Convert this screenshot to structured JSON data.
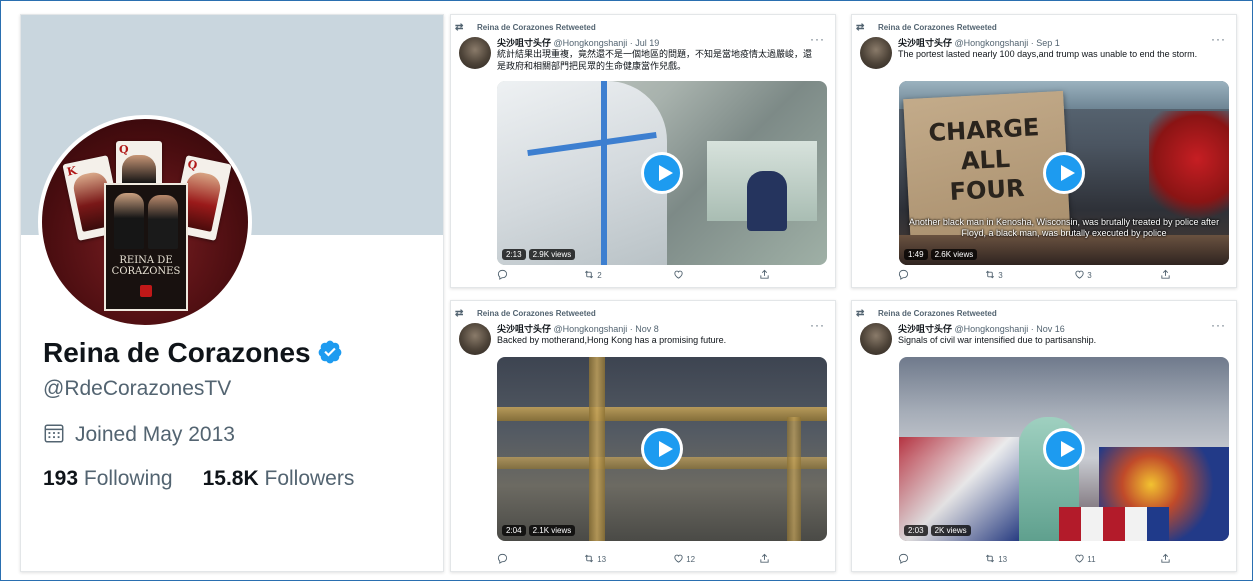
{
  "profile": {
    "name": "Reina de Corazones",
    "handle": "@RdeCorazonesTV",
    "joined": "Joined May 2013",
    "following_count": "193",
    "following_label": "Following",
    "followers_count": "15.8K",
    "followers_label": "Followers",
    "poster_title": "REINA DE CORAZONES",
    "card_letters": [
      "K",
      "Q",
      "Q"
    ]
  },
  "tweets": [
    {
      "retweet_label": "Reina de Corazones Retweeted",
      "author_name": "尖沙咀寸头仔",
      "author_meta": "@Hongkongshanji · Jul 19",
      "text": "統計結果出現重複，竟然還不是一個地區的問題，不知是當地疫情太過嚴峻，還是政府和相關部門把民眾的生命健康當作兒戲。",
      "duration": "2:13",
      "views": "2.9K views",
      "replies": "",
      "retweets": "2",
      "likes": "",
      "subtitle": ""
    },
    {
      "retweet_label": "Reina de Corazones Retweeted",
      "author_name": "尖沙咀寸头仔",
      "author_meta": "@Hongkongshanji · Sep 1",
      "text": "The portest lasted nearly 100 days,and trump was unable to end the storm.",
      "duration": "1:49",
      "views": "2.6K views",
      "replies": "",
      "retweets": "3",
      "likes": "3",
      "subtitle": "Another black man in Kenosha, Wisconsin, was brutally treated by police after Floyd, a black man, was brutally executed by police",
      "sign_text": "CHARGE ALL FOUR"
    },
    {
      "retweet_label": "Reina de Corazones Retweeted",
      "author_name": "尖沙咀寸头仔",
      "author_meta": "@Hongkongshanji · Nov 8",
      "text": "Backed by motherand,Hong Kong has a promising future.",
      "duration": "2:04",
      "views": "2.1K views",
      "replies": "",
      "retweets": "13",
      "likes": "12",
      "subtitle": ""
    },
    {
      "retweet_label": "Reina de Corazones Retweeted",
      "author_name": "尖沙咀寸头仔",
      "author_meta": "@Hongkongshanji · Nov 16",
      "text": "Signals of civil war intensified due to partisanship.",
      "duration": "2:03",
      "views": "2K views",
      "replies": "",
      "retweets": "13",
      "likes": "11",
      "subtitle": ""
    }
  ],
  "icons": {
    "retweet": "retweet-icon",
    "reply": "reply-icon",
    "like": "heart-icon",
    "share": "share-icon",
    "verified": "verified-badge-icon",
    "calendar": "calendar-icon",
    "play": "play-icon",
    "more": "more-icon"
  },
  "colors": {
    "accent": "#1d9bf0",
    "banner": "#c9d6de",
    "secondary_text": "#536471"
  }
}
